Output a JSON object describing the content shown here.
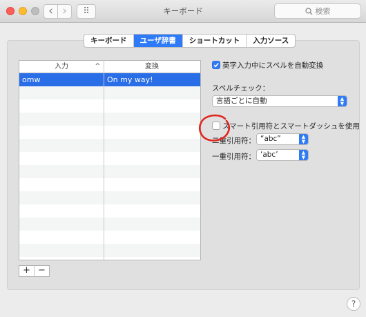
{
  "window": {
    "title": "キーボード",
    "search_placeholder": "検索",
    "back_glyph": "‹",
    "forward_glyph": "›",
    "grid_glyph": "⠿"
  },
  "tabs": [
    {
      "label": "キーボード",
      "active": false
    },
    {
      "label": "ユーザ辞書",
      "active": true
    },
    {
      "label": "ショートカット",
      "active": false
    },
    {
      "label": "入力ソース",
      "active": false
    }
  ],
  "table": {
    "columns": [
      "入力",
      "変換"
    ],
    "sort_indicator": "^",
    "rows": [
      {
        "input": "omw",
        "output": "On my way!",
        "selected": true
      }
    ]
  },
  "buttons": {
    "add": "+",
    "remove": "−",
    "help": "?"
  },
  "options": {
    "auto_correct": {
      "label": "英字入力中にスペルを自動変換",
      "checked": true
    },
    "spell_check": {
      "label": "スペルチェック：",
      "value": "言語ごとに自動"
    },
    "smart_quotes": {
      "label": "スマート引用符とスマートダッシュを使用",
      "checked": false
    },
    "double_quote": {
      "label": "二重引用符：",
      "value": "“abc”"
    },
    "single_quote": {
      "label": "一重引用符：",
      "value": "‘abc’"
    }
  },
  "colors": {
    "accent": "#2f7bf7",
    "annotation": "#e0261f"
  }
}
